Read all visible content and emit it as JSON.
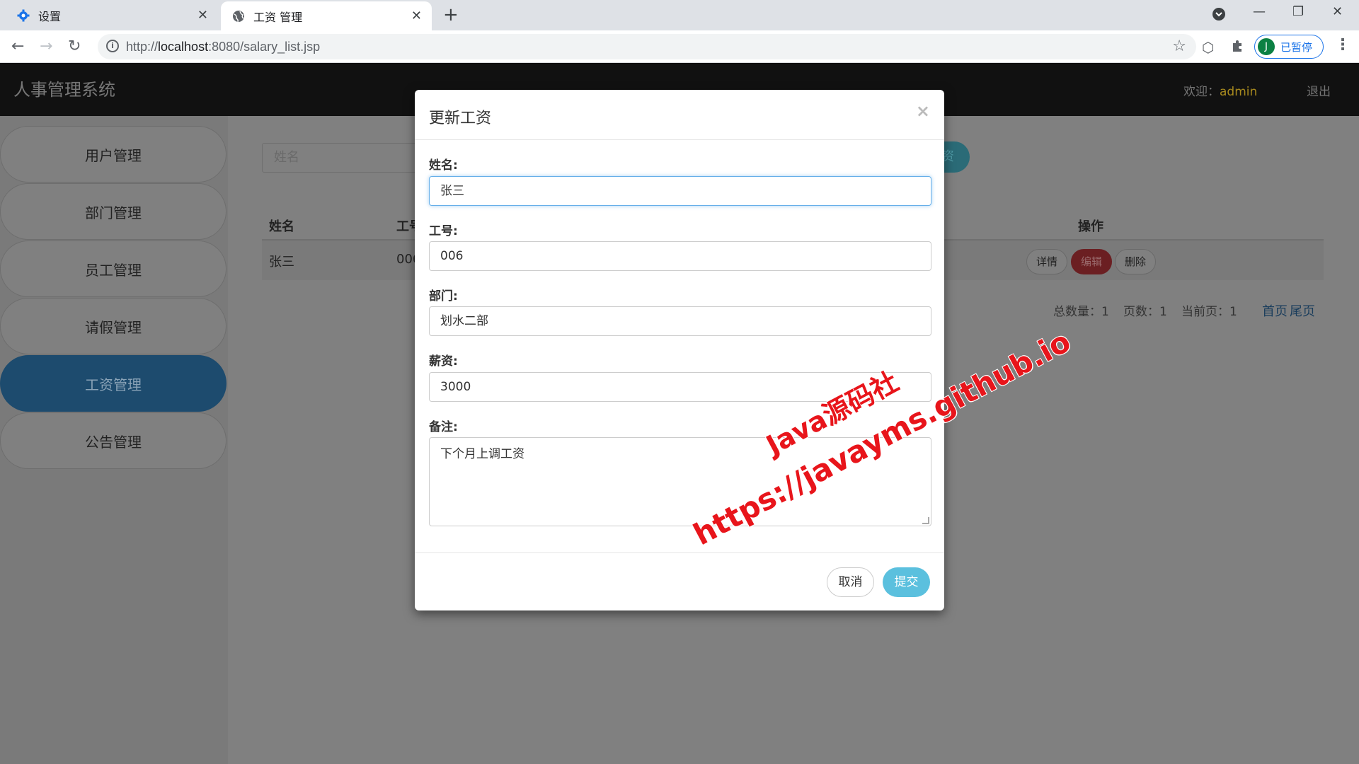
{
  "browser": {
    "tabs": [
      {
        "title": "设置",
        "icon": "gear-icon",
        "active": false
      },
      {
        "title": "工资 管理",
        "icon": "globe-icon",
        "active": true
      }
    ],
    "url_prefix": "http://",
    "url_host": "localhost",
    "url_rest": ":8080/salary_list.jsp",
    "profile_initial": "J",
    "profile_label": "已暂停",
    "accent": "#1a73e8"
  },
  "app": {
    "brand": "人事管理系统",
    "welcome_label": "欢迎：",
    "username": "admin",
    "logout": "退出"
  },
  "sidebar": {
    "items": [
      {
        "label": "用户管理",
        "active": false
      },
      {
        "label": "部门管理",
        "active": false
      },
      {
        "label": "员工管理",
        "active": false
      },
      {
        "label": "请假管理",
        "active": false
      },
      {
        "label": "工资管理",
        "active": true
      },
      {
        "label": "公告管理",
        "active": false
      }
    ]
  },
  "main": {
    "search_placeholder": "姓名",
    "add_button": "资",
    "columns": {
      "name": "姓名",
      "id": "工号",
      "ops": "操作"
    },
    "rows": [
      {
        "name": "张三",
        "id": "006"
      }
    ],
    "row_actions": {
      "detail": "详情",
      "edit": "编辑",
      "delete": "删除"
    },
    "pager": {
      "total_label": "总数量：1",
      "pages_label": "页数：1",
      "current_label": "当前页：1",
      "first": "首页",
      "last": "尾页"
    }
  },
  "modal": {
    "title": "更新工资",
    "close": "×",
    "fields": {
      "name_label": "姓名:",
      "name_value": "张三",
      "id_label": "工号:",
      "id_value": "006",
      "dept_label": "部门:",
      "dept_value": "划水二部",
      "salary_label": "薪资:",
      "salary_value": "3000",
      "note_label": "备注:",
      "note_value": "下个月上调工资"
    },
    "cancel": "取消",
    "submit": "提交"
  },
  "watermark": {
    "line1": "Java源码社",
    "line2": "https://javayms.github.io"
  }
}
